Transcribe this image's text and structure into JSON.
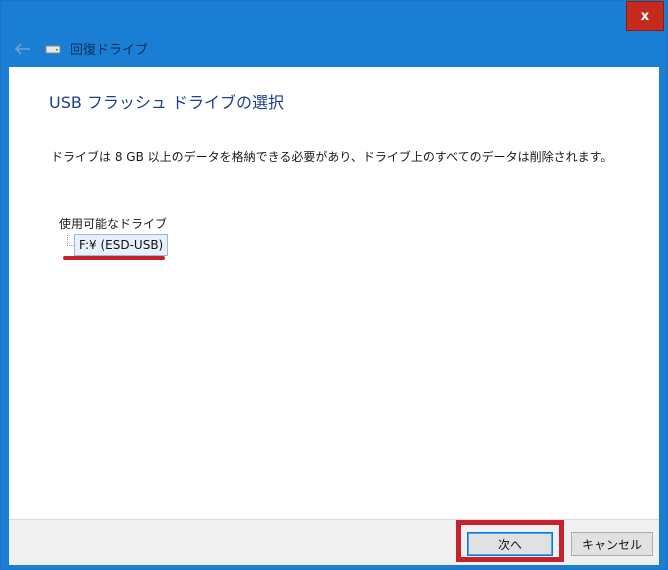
{
  "window": {
    "title": "回復ドライブ",
    "close_label": "x"
  },
  "page": {
    "heading": "USB フラッシュ ドライブの選択",
    "description": "ドライブは 8 GB 以上のデータを格納できる必要があり、ドライブ上のすべてのデータは削除されます。",
    "drives_label": "使用可能なドライブ",
    "drives": [
      {
        "label": "F:¥ (ESD-USB)",
        "selected": true
      }
    ]
  },
  "footer": {
    "next_label": "次へ",
    "cancel_label": "キャンセル"
  },
  "colors": {
    "titlebar": "#1a7fd4",
    "close": "#c42b1c",
    "heading": "#1e3f8a",
    "annotation": "#c4232e"
  },
  "icons": {
    "back": "back-arrow-icon",
    "drive": "drive-icon"
  }
}
